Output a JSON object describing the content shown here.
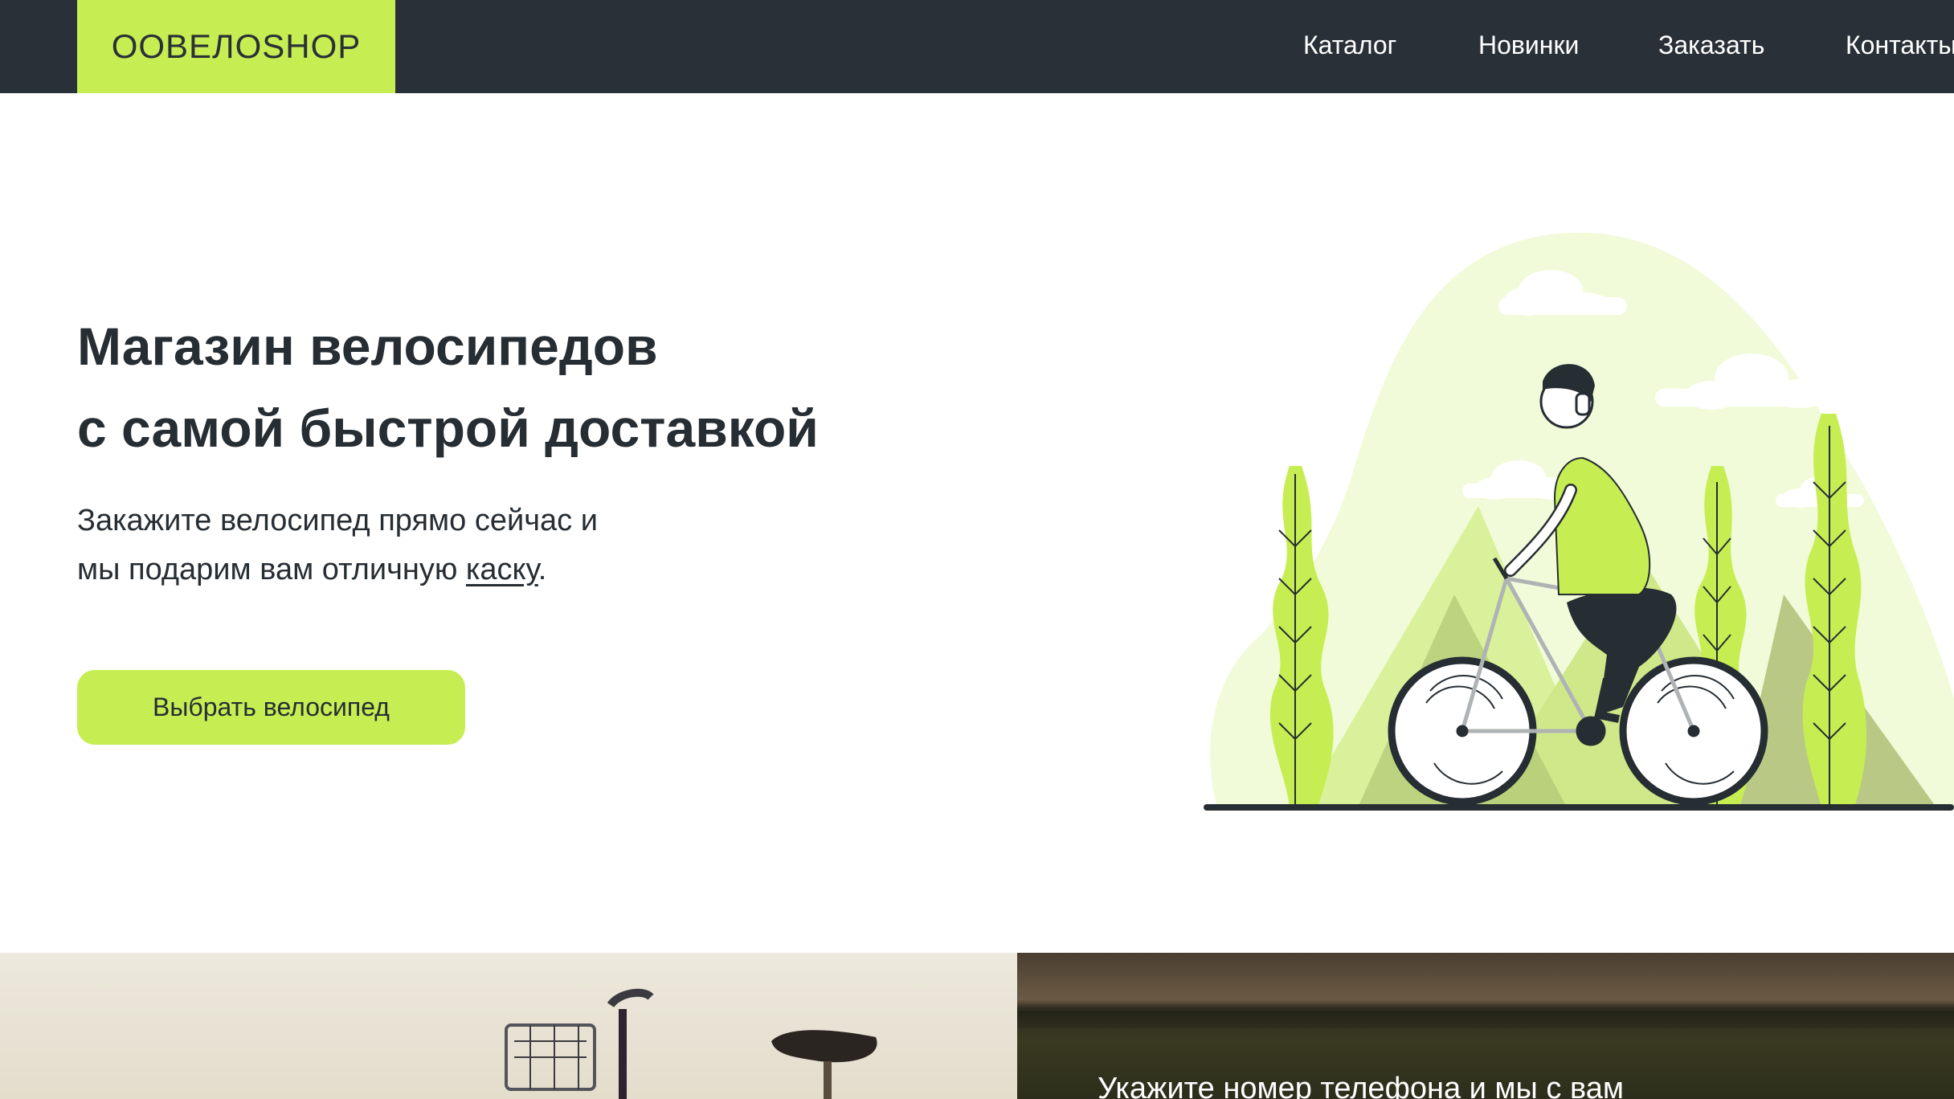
{
  "header": {
    "logo": "OOBEЛOSHOP",
    "nav": [
      {
        "label": "Каталог"
      },
      {
        "label": "Новинки"
      },
      {
        "label": "Заказать"
      },
      {
        "label": "Контакты"
      }
    ]
  },
  "hero": {
    "title_line1": "Магазин велосипедов",
    "title_line2": "с самой быстрой доставкой",
    "subtitle_line1": "Закажите велосипед прямо сейчас и",
    "subtitle_line2_prefix": "мы подарим вам отличную ",
    "subtitle_link": "каску",
    "subtitle_line2_suffix": ".",
    "cta_label": "Выбрать велосипед"
  },
  "callout": {
    "text": "Укажите номер телефона и мы с вам"
  },
  "colors": {
    "accent": "#c6ee52",
    "header_bg": "#2a3037",
    "text": "#262d33"
  }
}
